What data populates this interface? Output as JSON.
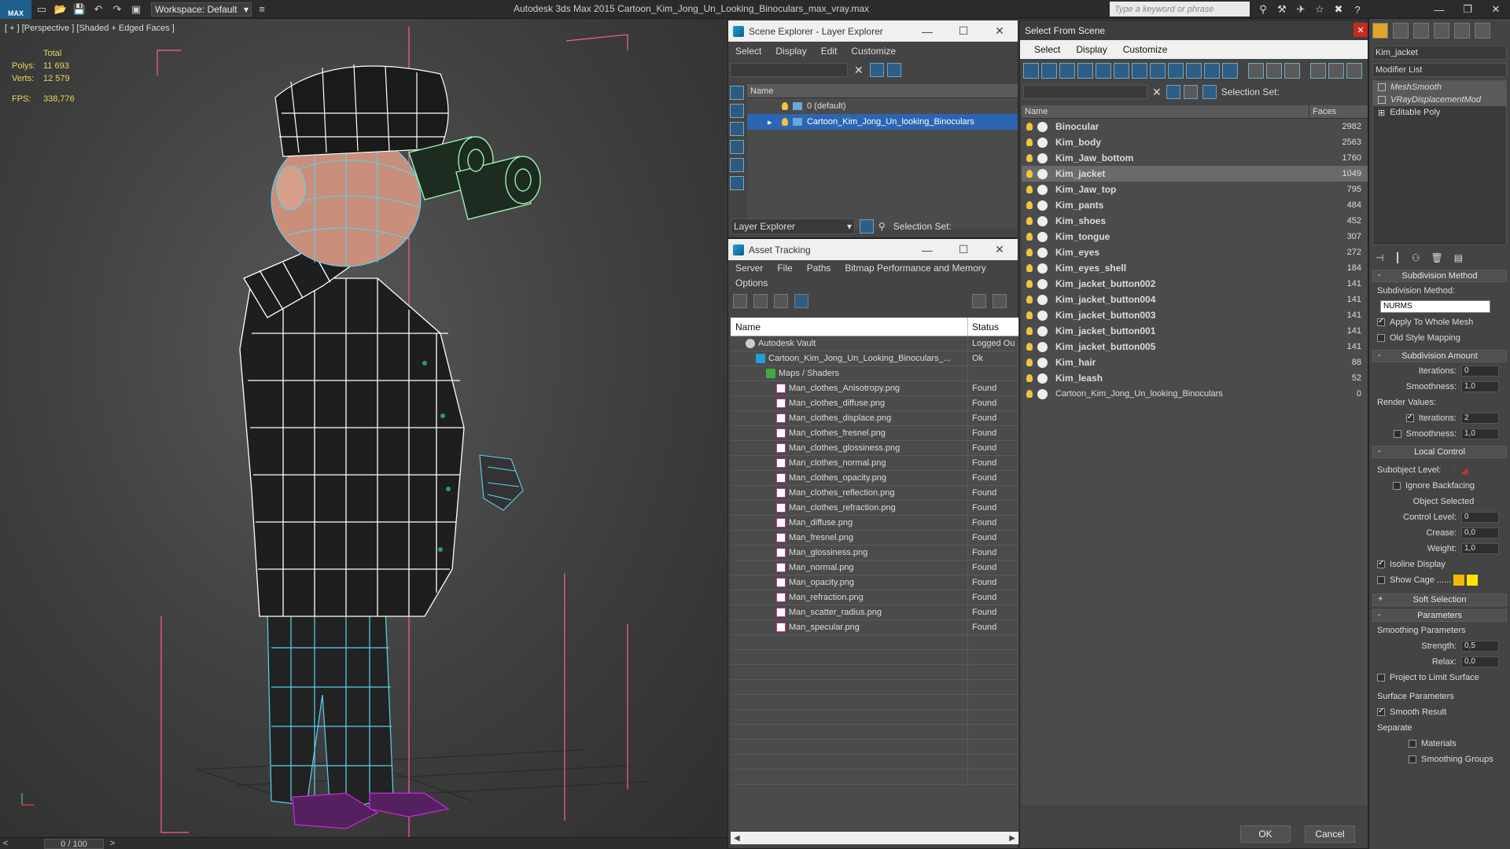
{
  "app": {
    "logo": "MAX",
    "workspace": "Workspace: Default",
    "title": "Autodesk 3ds Max  2015    Cartoon_Kim_Jong_Un_Looking_Binoculars_max_vray.max",
    "search_placeholder": "Type a keyword or phrase",
    "minimize": "—",
    "restore": "❐",
    "close": "✕"
  },
  "viewport": {
    "label": "[ + ] [Perspective ] [Shaded + Edged Faces ]",
    "stats": {
      "header": "Total",
      "polys_label": "Polys:",
      "polys": "11 693",
      "verts_label": "Verts:",
      "verts": "12 579",
      "fps_label": "FPS:",
      "fps": "338,776"
    },
    "timebar": {
      "prev": "<",
      "value": "0 / 100",
      "next": ">"
    }
  },
  "scene_explorer": {
    "title": "Scene Explorer - Layer Explorer",
    "menu": [
      "Select",
      "Display",
      "Edit",
      "Customize"
    ],
    "column": "Name",
    "rows": [
      {
        "label": "0 (default)",
        "selected": false
      },
      {
        "label": "Cartoon_Kim_Jong_Un_looking_Binoculars",
        "selected": true
      }
    ],
    "bottom_dropdown": "Layer Explorer",
    "selection_set": "Selection Set:"
  },
  "asset_tracking": {
    "title": "Asset Tracking",
    "menu": [
      "Server",
      "File",
      "Paths",
      "Bitmap Performance and Memory"
    ],
    "menu2": "Options",
    "col_name": "Name",
    "col_status": "Status",
    "rows": [
      {
        "name": "Autodesk Vault",
        "status": "Logged Ou",
        "indent": 1,
        "icon": "vault"
      },
      {
        "name": "Cartoon_Kim_Jong_Un_Looking_Binoculars_...",
        "status": "Ok",
        "indent": 2,
        "icon": "file"
      },
      {
        "name": "Maps / Shaders",
        "status": "",
        "indent": 3,
        "icon": "folder"
      },
      {
        "name": "Man_clothes_Anisotropy.png",
        "status": "Found",
        "indent": 4,
        "icon": "png"
      },
      {
        "name": "Man_clothes_diffuse.png",
        "status": "Found",
        "indent": 4,
        "icon": "png"
      },
      {
        "name": "Man_clothes_displace.png",
        "status": "Found",
        "indent": 4,
        "icon": "png"
      },
      {
        "name": "Man_clothes_fresnel.png",
        "status": "Found",
        "indent": 4,
        "icon": "png"
      },
      {
        "name": "Man_clothes_glossiness.png",
        "status": "Found",
        "indent": 4,
        "icon": "png"
      },
      {
        "name": "Man_clothes_normal.png",
        "status": "Found",
        "indent": 4,
        "icon": "png"
      },
      {
        "name": "Man_clothes_opacity.png",
        "status": "Found",
        "indent": 4,
        "icon": "png"
      },
      {
        "name": "Man_clothes_reflection.png",
        "status": "Found",
        "indent": 4,
        "icon": "png"
      },
      {
        "name": "Man_clothes_refraction.png",
        "status": "Found",
        "indent": 4,
        "icon": "png"
      },
      {
        "name": "Man_diffuse.png",
        "status": "Found",
        "indent": 4,
        "icon": "png"
      },
      {
        "name": "Man_fresnel.png",
        "status": "Found",
        "indent": 4,
        "icon": "png"
      },
      {
        "name": "Man_glossiness.png",
        "status": "Found",
        "indent": 4,
        "icon": "png"
      },
      {
        "name": "Man_normal.png",
        "status": "Found",
        "indent": 4,
        "icon": "png"
      },
      {
        "name": "Man_opacity.png",
        "status": "Found",
        "indent": 4,
        "icon": "png"
      },
      {
        "name": "Man_refraction.png",
        "status": "Found",
        "indent": 4,
        "icon": "png"
      },
      {
        "name": "Man_scatter_radius.png",
        "status": "Found",
        "indent": 4,
        "icon": "png"
      },
      {
        "name": "Man_specular.png",
        "status": "Found",
        "indent": 4,
        "icon": "png"
      }
    ]
  },
  "select_from_scene": {
    "title": "Select From Scene",
    "menu": [
      "Select",
      "Display",
      "Customize"
    ],
    "selection_set": "Selection Set:",
    "col_name": "Name",
    "col_faces": "Faces",
    "rows": [
      {
        "name": "Binocular",
        "faces": "2982",
        "selected": false
      },
      {
        "name": "Kim_body",
        "faces": "2563",
        "selected": false
      },
      {
        "name": "Kim_Jaw_bottom",
        "faces": "1760",
        "selected": false
      },
      {
        "name": "Kim_jacket",
        "faces": "1049",
        "selected": true
      },
      {
        "name": "Kim_Jaw_top",
        "faces": "795",
        "selected": false
      },
      {
        "name": "Kim_pants",
        "faces": "484",
        "selected": false
      },
      {
        "name": "Kim_shoes",
        "faces": "452",
        "selected": false
      },
      {
        "name": "Kim_tongue",
        "faces": "307",
        "selected": false
      },
      {
        "name": "Kim_eyes",
        "faces": "272",
        "selected": false
      },
      {
        "name": "Kim_eyes_shell",
        "faces": "184",
        "selected": false
      },
      {
        "name": "Kim_jacket_button002",
        "faces": "141",
        "selected": false
      },
      {
        "name": "Kim_jacket_button004",
        "faces": "141",
        "selected": false
      },
      {
        "name": "Kim_jacket_button003",
        "faces": "141",
        "selected": false
      },
      {
        "name": "Kim_jacket_button001",
        "faces": "141",
        "selected": false
      },
      {
        "name": "Kim_jacket_button005",
        "faces": "141",
        "selected": false
      },
      {
        "name": "Kim_hair",
        "faces": "88",
        "selected": false
      },
      {
        "name": "Kim_leash",
        "faces": "52",
        "selected": false
      },
      {
        "name": "Cartoon_Kim_Jong_Un_looking_Binoculars",
        "faces": "0",
        "selected": false,
        "plain": true
      }
    ],
    "ok": "OK",
    "cancel": "Cancel"
  },
  "command_panel": {
    "object_name": "Kim_jacket",
    "modifier_list": "Modifier List",
    "stack": [
      "MeshSmooth",
      "VRayDisplacementMod",
      "Editable Poly"
    ],
    "subdivision_method": {
      "title": "Subdivision Method",
      "label": "Subdivision Method:",
      "value": "NURMS",
      "apply_whole": "Apply To Whole Mesh",
      "old_style": "Old Style Mapping"
    },
    "subdivision_amount": {
      "title": "Subdivision Amount",
      "iterations_label": "Iterations:",
      "iterations": "0",
      "smoothness_label": "Smoothness:",
      "smoothness": "1,0",
      "render_values": "Render Values:",
      "r_iterations": "2",
      "r_smoothness": "1,0"
    },
    "local_control": {
      "title": "Local Control",
      "subobject": "Subobject Level:",
      "ignore_backfacing": "Ignore Backfacing",
      "object_selected": "Object Selected",
      "control_level_label": "Control Level:",
      "control_level": "0",
      "crease_label": "Crease:",
      "crease": "0,0",
      "weight_label": "Weight:",
      "weight": "1,0",
      "isoline": "Isoline Display",
      "show_cage": "Show Cage ......"
    },
    "soft_selection": "Soft Selection",
    "parameters": {
      "title": "Parameters",
      "smoothing": "Smoothing Parameters",
      "strength_label": "Strength:",
      "strength": "0,5",
      "relax_label": "Relax:",
      "relax": "0,0",
      "project": "Project to Limit Surface",
      "surface": "Surface Parameters",
      "smooth_result": "Smooth Result",
      "separate": "Separate",
      "materials": "Materials",
      "smoothing_groups": "Smoothing Groups"
    },
    "colors": {
      "cage1": "#f5b800",
      "cage2": "#ffe400"
    }
  },
  "colors": {
    "wire_cyan": "#5ad3f0",
    "wire_white": "#ffffff",
    "binocular": "#9cf0b0",
    "shoes": "#c82cdc",
    "bbox": "#ff5aa8",
    "selection": "#2c65b4"
  }
}
